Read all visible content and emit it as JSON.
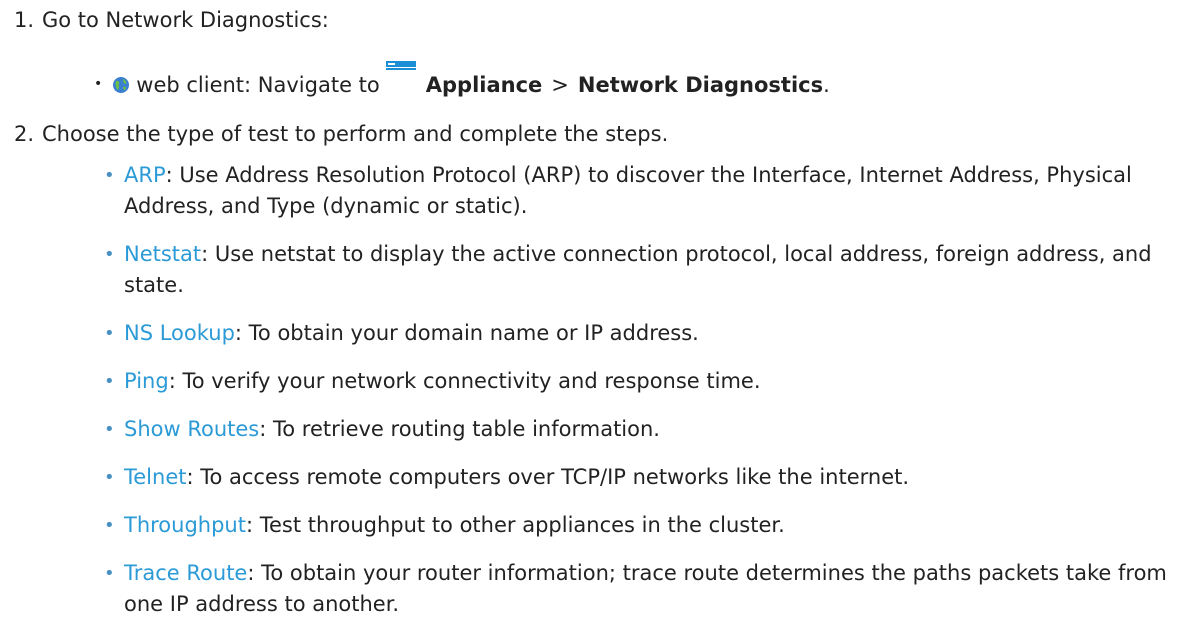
{
  "steps": [
    {
      "number": "1.",
      "text": "Go to Network Diagnostics:"
    },
    {
      "number": "2.",
      "text": "Choose the type of test to perform and complete the steps."
    }
  ],
  "navigation": {
    "bullet": "•",
    "client_label": "web client: Navigate to",
    "appliance": "Appliance",
    "separator": ">",
    "target": "Network Diagnostics",
    "end": ".",
    "icons": [
      "globe-icon",
      "appliance-icon"
    ],
    "colors": {
      "globe": "#3a7fd0",
      "appliance": "#1a8fd6"
    }
  },
  "tests": [
    {
      "link": "ARP",
      "desc": ": Use Address Resolution Protocol (ARP) to discover the Interface, Internet Address, Physical Address, and Type (dynamic or static)."
    },
    {
      "link": "Netstat",
      "desc": ": Use netstat to display the active connection protocol, local address, foreign address, and state."
    },
    {
      "link": "NS Lookup",
      "desc": ": To obtain your domain name or IP address."
    },
    {
      "link": "Ping",
      "desc": ": To verify your network connectivity and response time."
    },
    {
      "link": "Show Routes",
      "desc": ": To retrieve routing table information."
    },
    {
      "link": "Telnet",
      "desc": ": To access remote computers over TCP/IP networks like the internet."
    },
    {
      "link": "Throughput",
      "desc": ": Test throughput to other appliances in the cluster."
    },
    {
      "link": "Trace Route",
      "desc": ": To obtain your router information; trace route determines the paths packets take from one IP address to another."
    }
  ],
  "colors": {
    "link": "#2b9ad6",
    "bullet": "#4a90c4",
    "text": "#222222"
  }
}
